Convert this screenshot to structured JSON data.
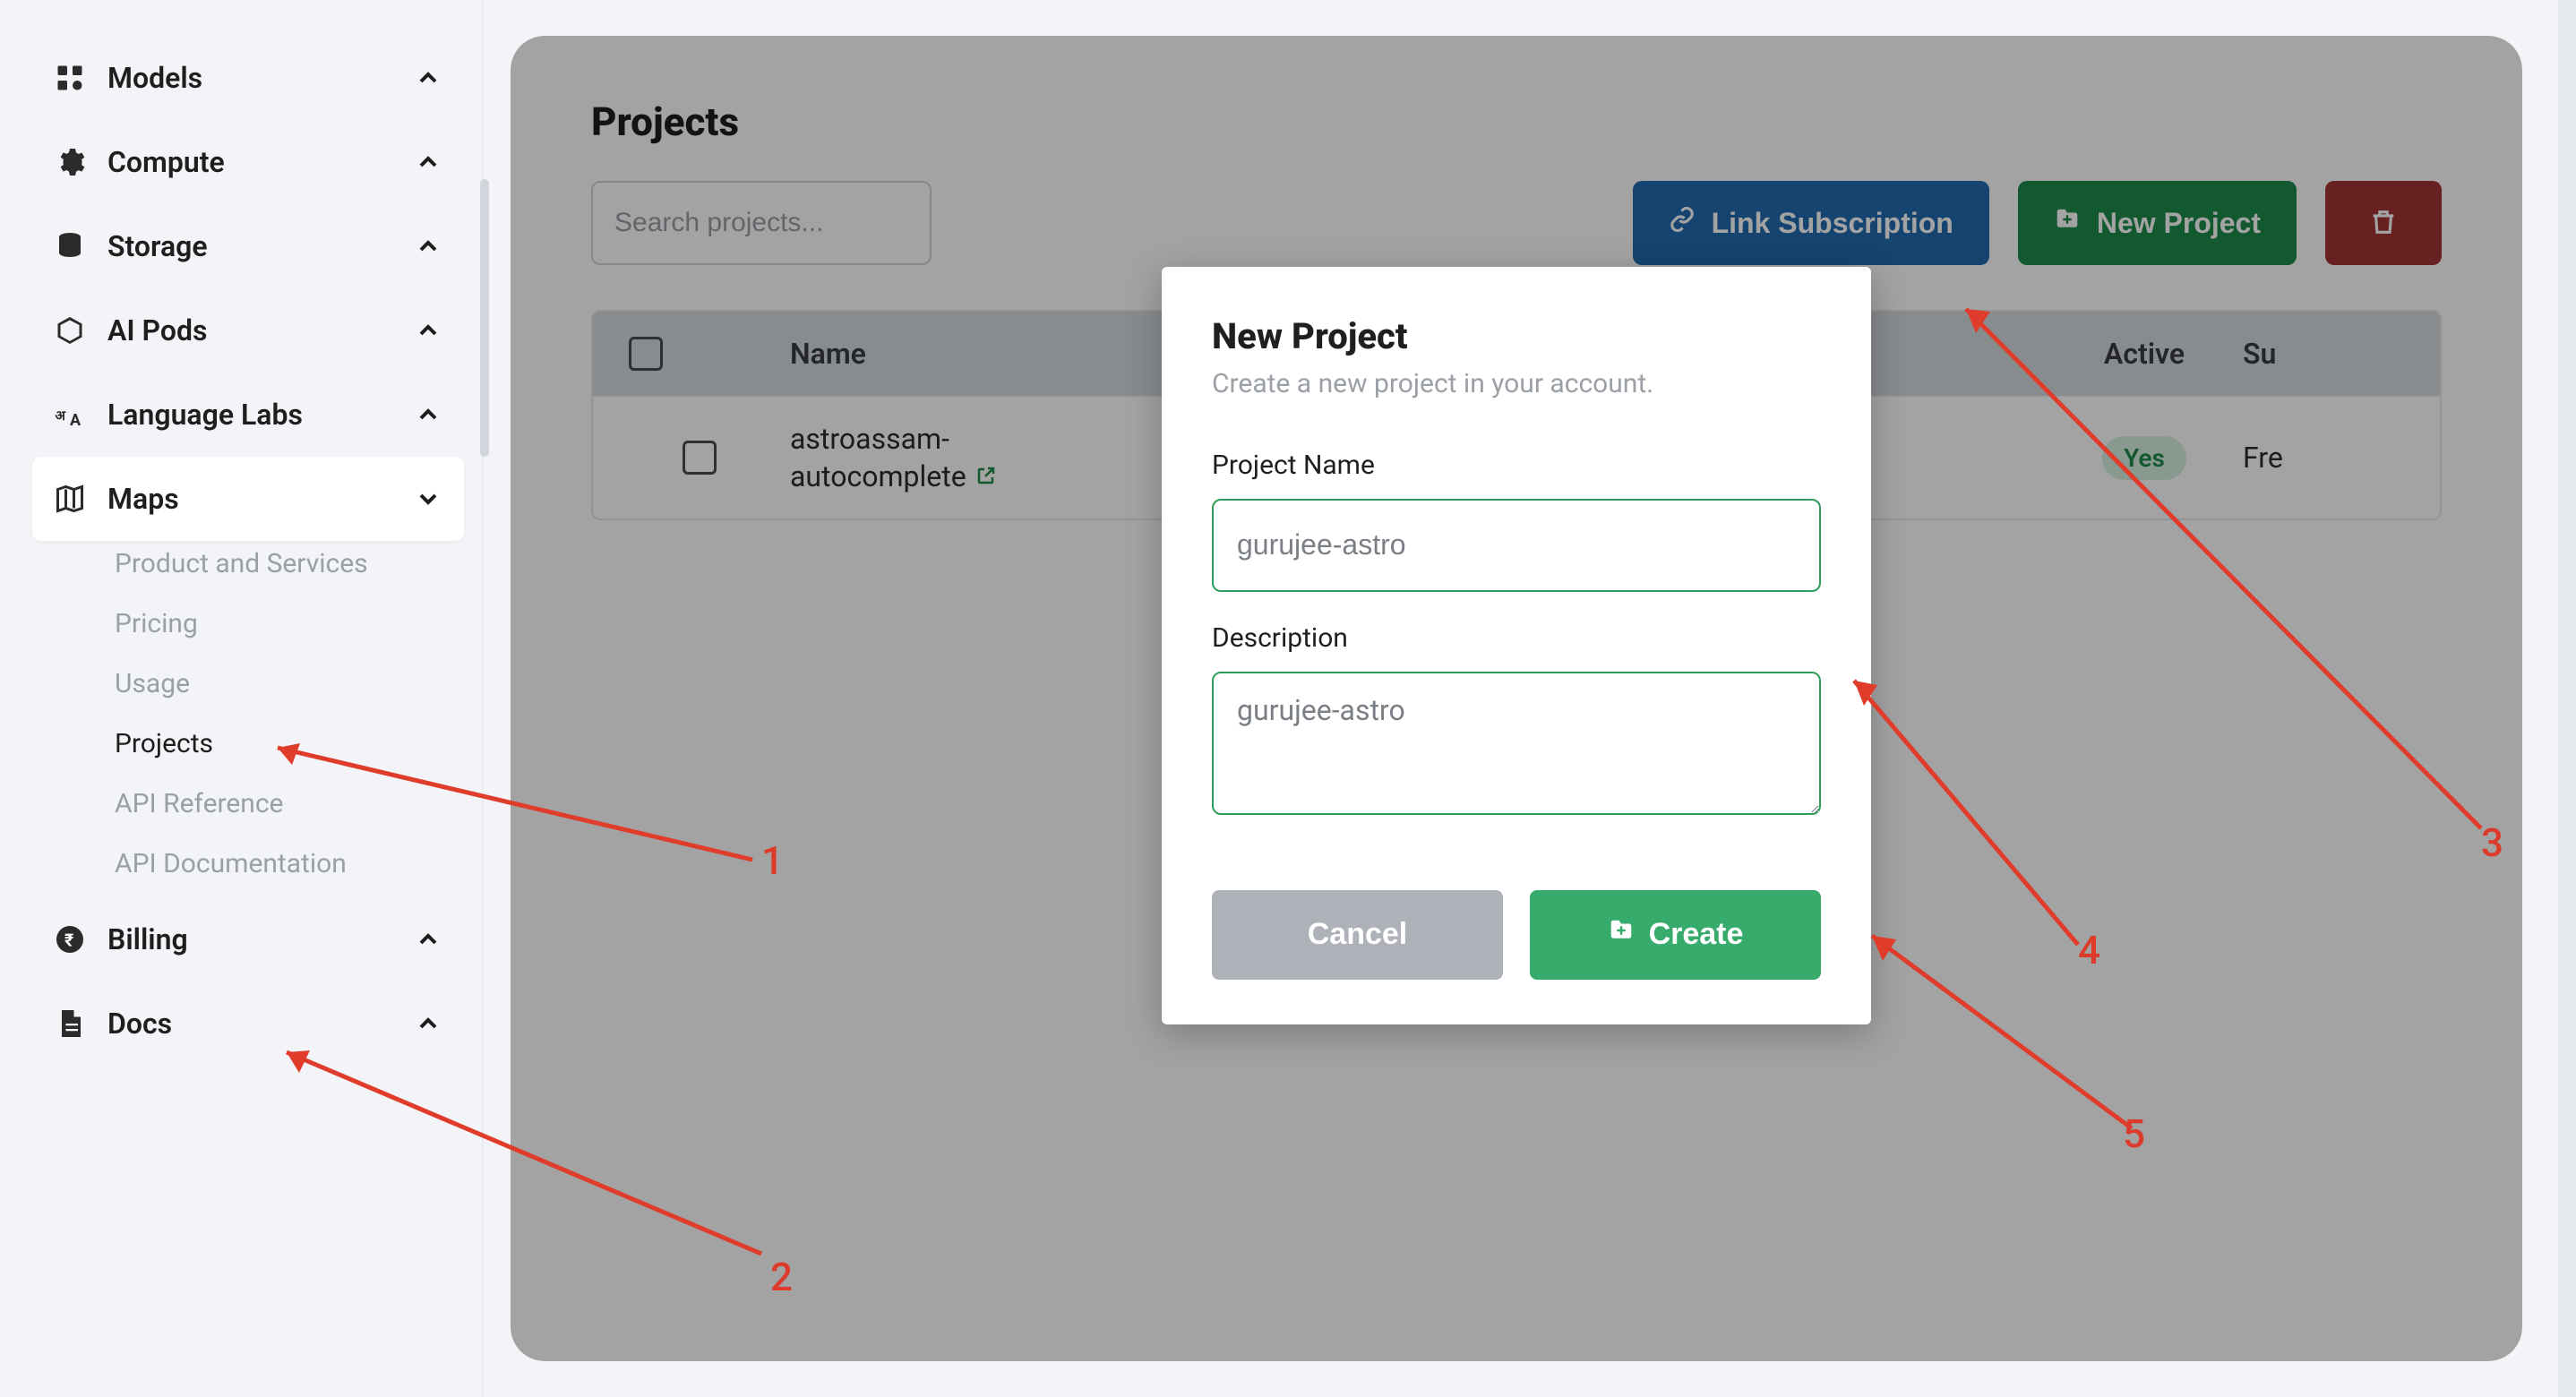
{
  "sidebar": {
    "items": [
      {
        "label": "Models",
        "icon": "categories-icon"
      },
      {
        "label": "Compute",
        "icon": "gear-icon"
      },
      {
        "label": "Storage",
        "icon": "database-icon"
      },
      {
        "label": "AI Pods",
        "icon": "cube-icon"
      },
      {
        "label": "Language Labs",
        "icon": "lang-icon"
      },
      {
        "label": "Maps",
        "icon": "maps-icon"
      },
      {
        "label": "Billing",
        "icon": "rupee-icon"
      },
      {
        "label": "Docs",
        "icon": "document-icon"
      }
    ],
    "maps_subitems": [
      "Product and Services",
      "Pricing",
      "Usage",
      "Projects",
      "API Reference",
      "API Documentation"
    ]
  },
  "page": {
    "title": "Projects",
    "search_placeholder": "Search projects...",
    "link_subscription_label": "Link Subscription",
    "new_project_label": "New Project"
  },
  "table": {
    "headers": {
      "name": "Name",
      "active": "Active",
      "su": "Su"
    },
    "rows": [
      {
        "name_line1": "astroassam-",
        "name_line2": "autocomplete",
        "active": "Yes",
        "su": "Fre"
      }
    ]
  },
  "modal": {
    "title": "New Project",
    "subtitle": "Create a new project in your account.",
    "project_name_label": "Project Name",
    "project_name_value": "gurujee-astro",
    "description_label": "Description",
    "description_value": "gurujee-astro",
    "cancel_label": "Cancel",
    "create_label": "Create"
  },
  "annotations": {
    "n1": "1",
    "n2": "2",
    "n3": "3",
    "n4": "4",
    "n5": "5"
  },
  "colors": {
    "blue": "#226bb0",
    "greenDark": "#1f8b4c",
    "green": "#37ab6c",
    "red": "#a33434",
    "arrow": "#e03c2b"
  }
}
